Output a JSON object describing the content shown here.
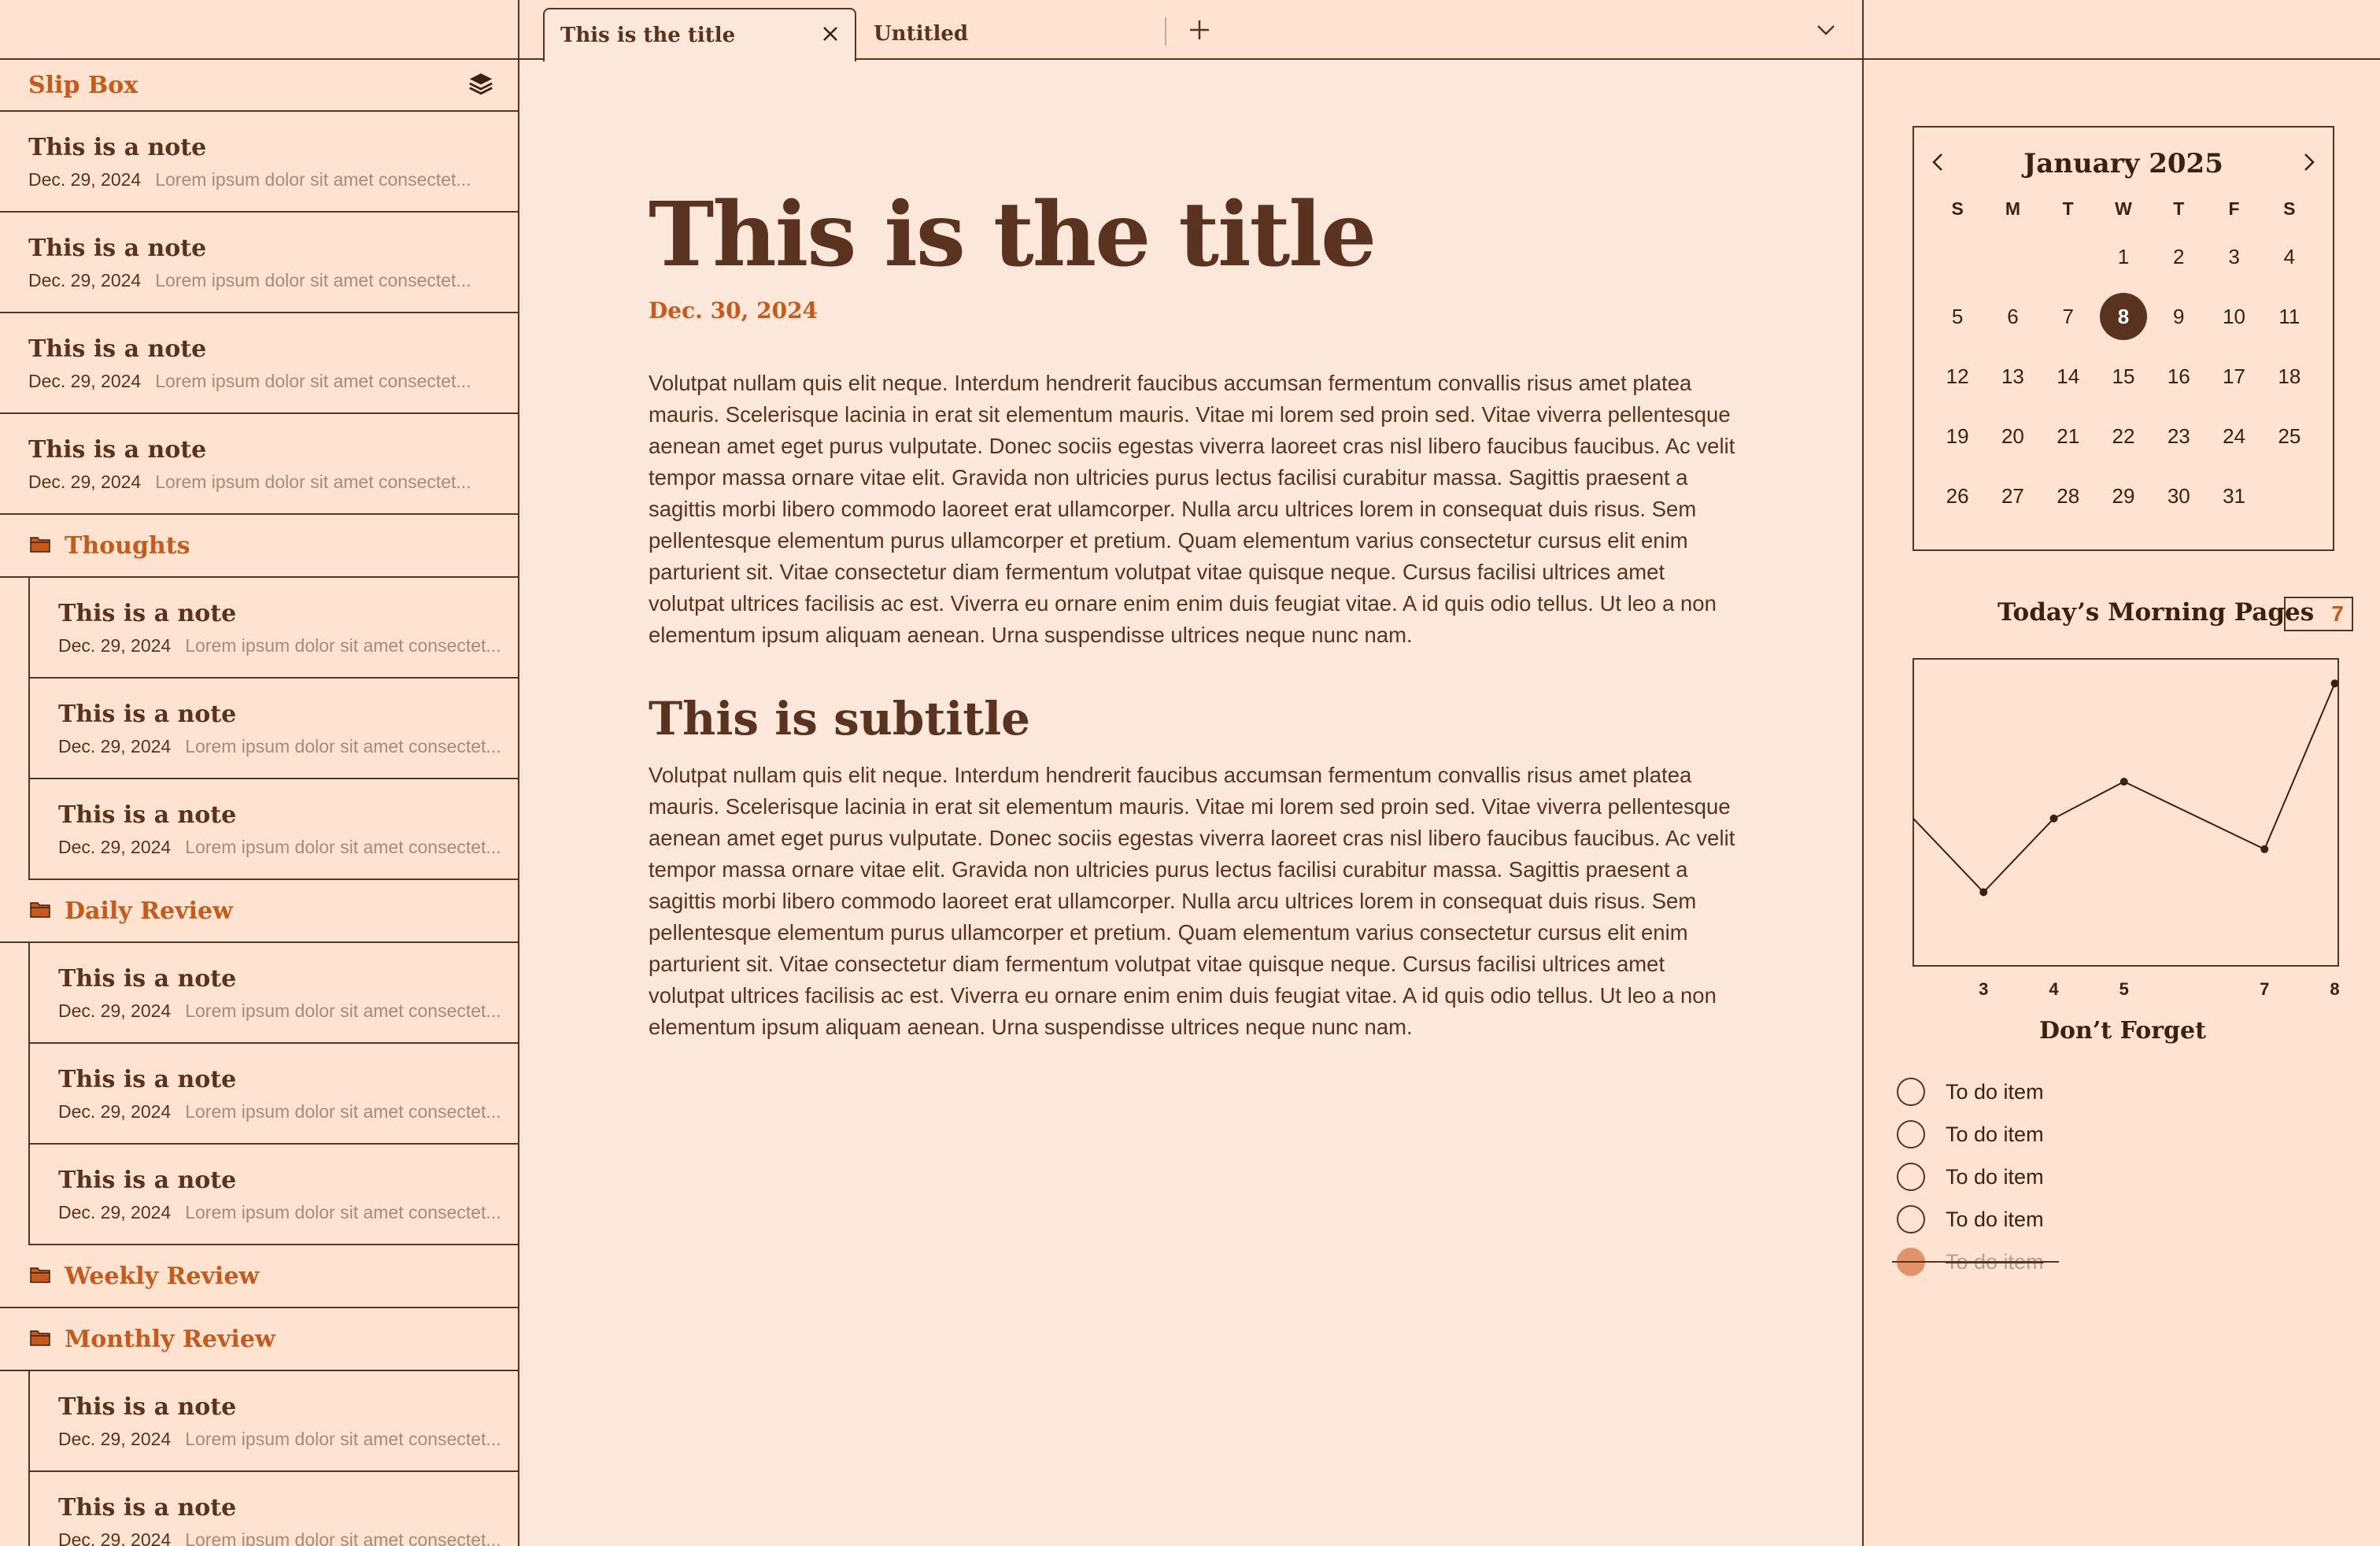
{
  "sidebar": {
    "title": "Slip Box",
    "root_notes": [
      {
        "title": "This is a note",
        "date": "Dec. 29, 2024",
        "preview": "Lorem ipsum dolor sit amet consectet..."
      },
      {
        "title": "This is a note",
        "date": "Dec. 29, 2024",
        "preview": "Lorem ipsum dolor sit amet consectet..."
      },
      {
        "title": "This is a note",
        "date": "Dec. 29, 2024",
        "preview": "Lorem ipsum dolor sit amet consectet..."
      },
      {
        "title": "This is a note",
        "date": "Dec. 29, 2024",
        "preview": "Lorem ipsum dolor sit amet consectet..."
      }
    ],
    "folders": [
      {
        "name": "Thoughts",
        "notes": [
          {
            "title": "This is a note",
            "date": "Dec. 29, 2024",
            "preview": "Lorem ipsum dolor sit amet consectet..."
          },
          {
            "title": "This is a note",
            "date": "Dec. 29, 2024",
            "preview": "Lorem ipsum dolor sit amet consectet..."
          },
          {
            "title": "This is a note",
            "date": "Dec. 29, 2024",
            "preview": "Lorem ipsum dolor sit amet consectet..."
          }
        ]
      },
      {
        "name": "Daily Review",
        "notes": [
          {
            "title": "This is a note",
            "date": "Dec. 29, 2024",
            "preview": "Lorem ipsum dolor sit amet consectet..."
          },
          {
            "title": "This is a note",
            "date": "Dec. 29, 2024",
            "preview": "Lorem ipsum dolor sit amet consectet..."
          },
          {
            "title": "This is a note",
            "date": "Dec. 29, 2024",
            "preview": "Lorem ipsum dolor sit amet consectet..."
          }
        ]
      },
      {
        "name": "Weekly Review",
        "notes": []
      },
      {
        "name": "Monthly Review",
        "notes": [
          {
            "title": "This is a note",
            "date": "Dec. 29, 2024",
            "preview": "Lorem ipsum dolor sit amet consectet..."
          },
          {
            "title": "This is a note",
            "date": "Dec. 29, 2024",
            "preview": "Lorem ipsum dolor sit amet consectet..."
          }
        ]
      }
    ]
  },
  "tabs": [
    {
      "label": "This is the title",
      "active": true
    },
    {
      "label": "Untitled",
      "active": false
    }
  ],
  "document": {
    "title": "This is the title",
    "date": "Dec. 30, 2024",
    "paragraph1": "Volutpat nullam quis elit neque. Interdum hendrerit faucibus accumsan fermentum convallis risus amet platea mauris. Scelerisque lacinia in erat sit elementum mauris. Vitae mi lorem sed proin sed. Vitae viverra pellentesque aenean amet eget purus vulputate. Donec sociis egestas viverra laoreet cras nisl libero faucibus faucibus. Ac velit tempor massa ornare vitae elit. Gravida non ultricies purus lectus facilisi curabitur massa. Sagittis praesent a sagittis morbi libero commodo laoreet erat ullamcorper. Nulla arcu ultrices lorem in consequat duis risus. Sem pellentesque elementum purus ullamcorper et pretium. Quam elementum varius consectetur cursus elit enim parturient sit. Vitae consectetur diam fermentum volutpat vitae quisque neque. Cursus facilisi ultrices amet volutpat ultrices facilisis ac est. Viverra eu ornare enim enim duis feugiat vitae. A id quis odio tellus. Ut leo a non elementum ipsum aliquam aenean. Urna suspendisse ultrices neque nunc nam.",
    "subtitle": "This is subtitle",
    "paragraph2": "Volutpat nullam quis elit neque. Interdum hendrerit faucibus accumsan fermentum convallis risus amet platea mauris. Scelerisque lacinia in erat sit elementum mauris. Vitae mi lorem sed proin sed. Vitae viverra pellentesque aenean amet eget purus vulputate. Donec sociis egestas viverra laoreet cras nisl libero faucibus faucibus. Ac velit tempor massa ornare vitae elit. Gravida non ultricies purus lectus facilisi curabitur massa. Sagittis praesent a sagittis morbi libero commodo laoreet erat ullamcorper. Nulla arcu ultrices lorem in consequat duis risus. Sem pellentesque elementum purus ullamcorper et pretium. Quam elementum varius consectetur cursus elit enim parturient sit. Vitae consectetur diam fermentum volutpat vitae quisque neque. Cursus facilisi ultrices amet volutpat ultrices facilisis ac est. Viverra eu ornare enim enim duis feugiat vitae. A id quis odio tellus. Ut leo a non elementum ipsum aliquam aenean. Urna suspendisse ultrices neque nunc nam."
  },
  "calendar": {
    "month_label": "January 2025",
    "weekdays": [
      "S",
      "M",
      "T",
      "W",
      "T",
      "F",
      "S"
    ],
    "first_weekday_index": 3,
    "days_in_month": 31,
    "selected_day": 8
  },
  "morning_pages": {
    "label": "Today’s Morning Pages",
    "count": "7"
  },
  "chart_data": {
    "type": "line",
    "x": [
      2,
      3,
      4,
      5,
      7,
      8
    ],
    "x_tick_labels": [
      "3",
      "4",
      "5",
      "7",
      "8"
    ],
    "values": [
      2.4,
      1.2,
      2.4,
      3.0,
      1.9,
      4.6
    ],
    "ylim": [
      0,
      5
    ],
    "grid": false,
    "color": "#3d2010"
  },
  "todo": {
    "title": "Don’t Forget",
    "items": [
      {
        "label": "To do item",
        "done": false
      },
      {
        "label": "To do item",
        "done": false
      },
      {
        "label": "To do item",
        "done": false
      },
      {
        "label": "To do item",
        "done": false
      },
      {
        "label": "To do item",
        "done": true
      }
    ]
  },
  "colors": {
    "accent": "#c75a1a",
    "text": "#5a3220",
    "background": "#fce8db",
    "done_circle": "#e1946a"
  }
}
